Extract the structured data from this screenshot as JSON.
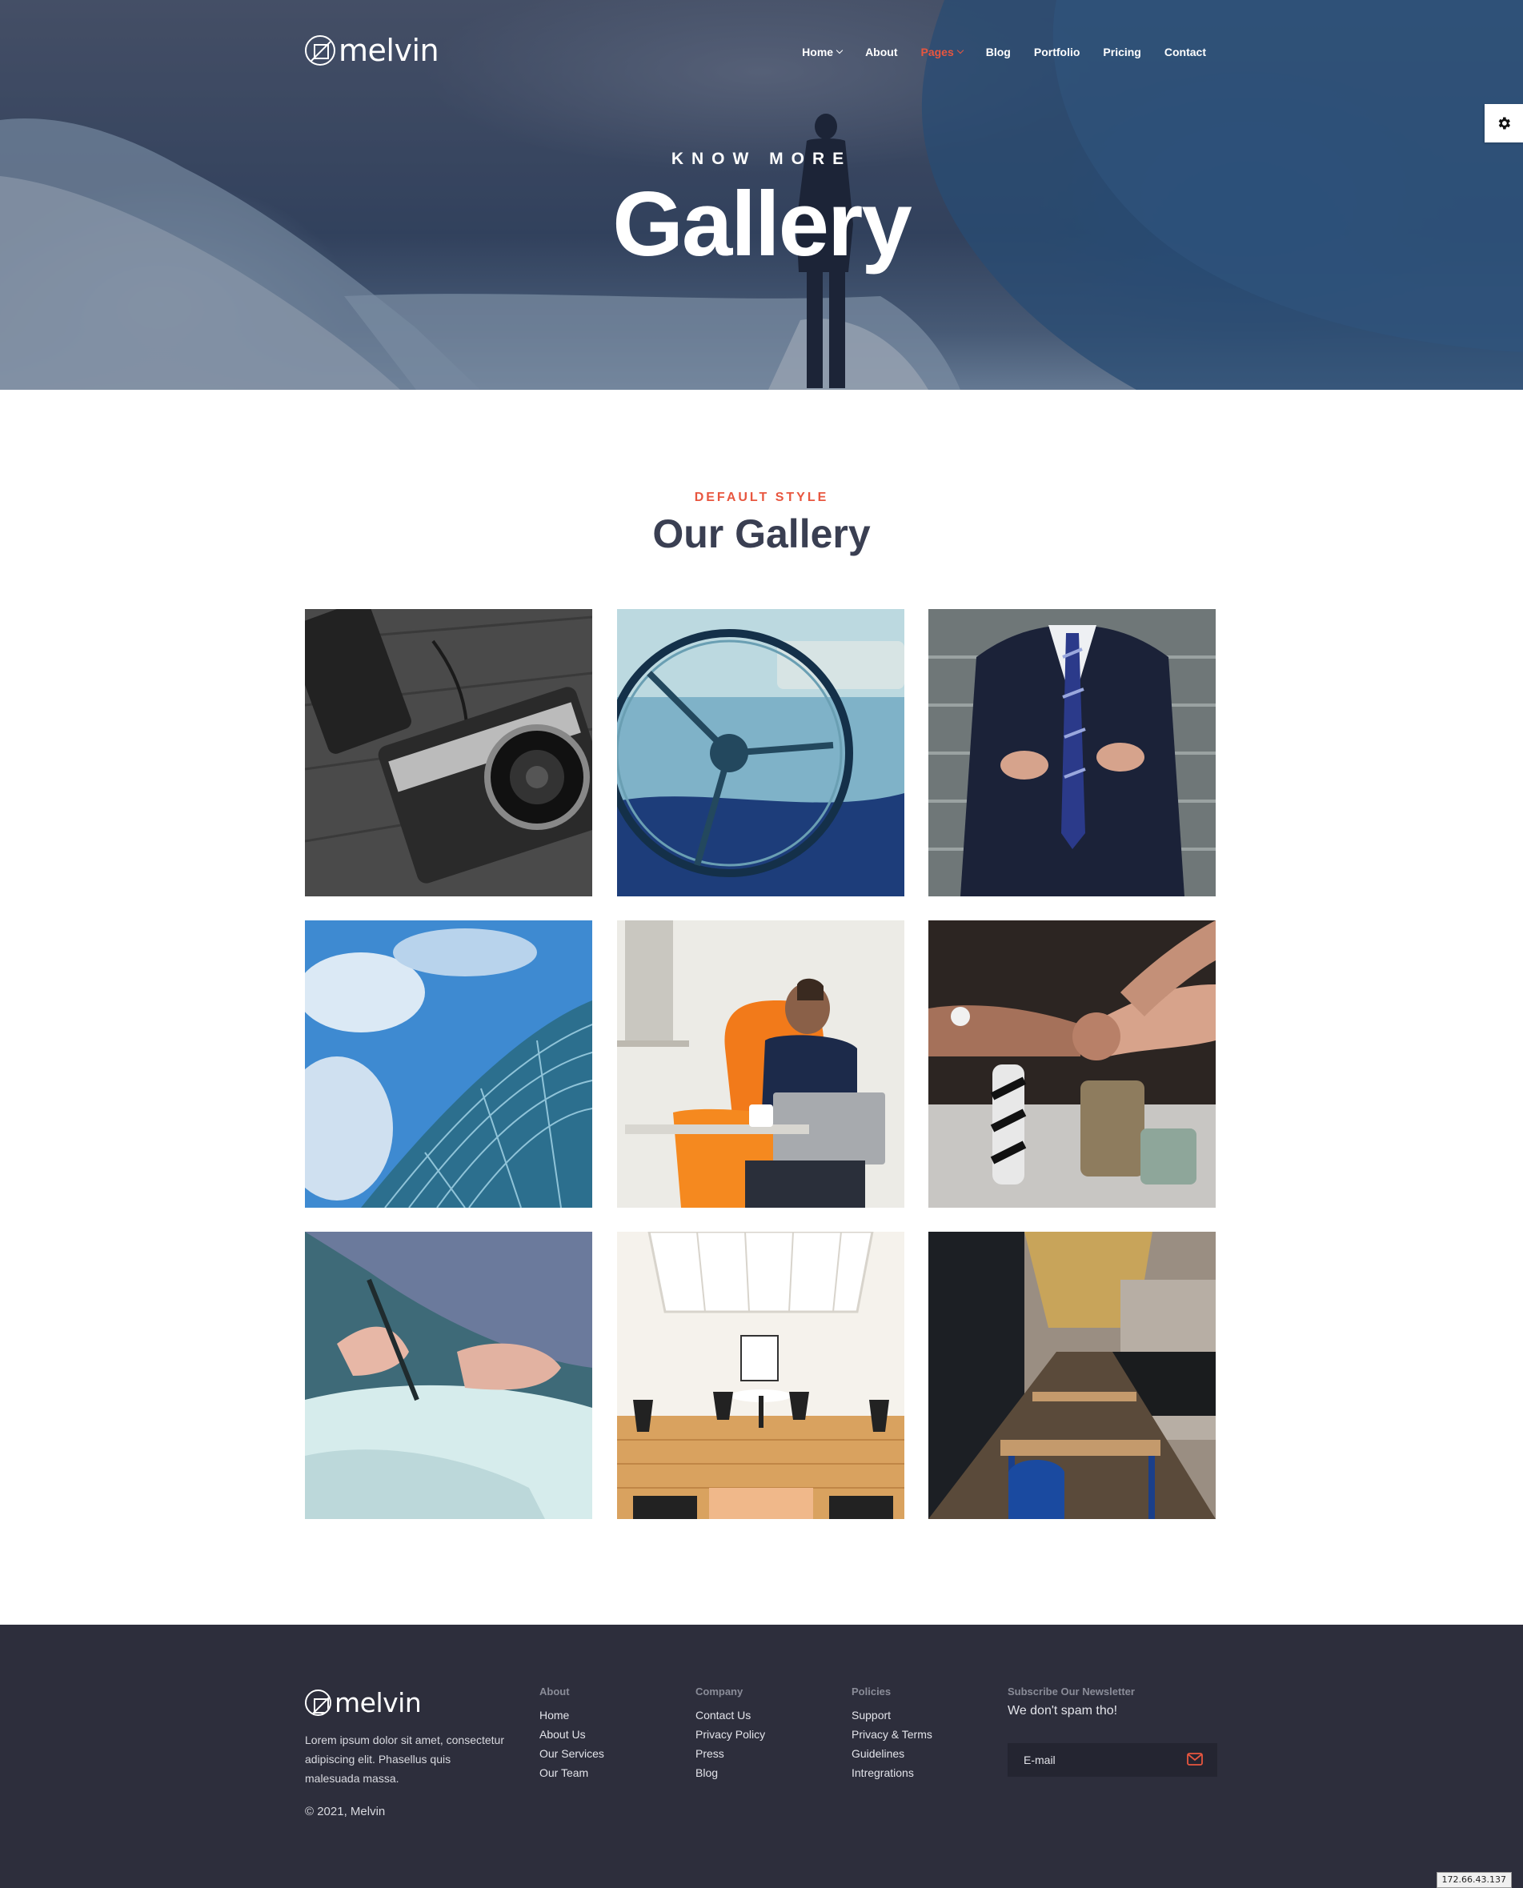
{
  "brand": {
    "name": "melvin"
  },
  "nav": {
    "items": [
      {
        "label": "Home",
        "has_dropdown": true,
        "active": false
      },
      {
        "label": "About",
        "has_dropdown": false,
        "active": false
      },
      {
        "label": "Pages",
        "has_dropdown": true,
        "active": true
      },
      {
        "label": "Blog",
        "has_dropdown": false,
        "active": false
      },
      {
        "label": "Portfolio",
        "has_dropdown": false,
        "active": false
      },
      {
        "label": "Pricing",
        "has_dropdown": false,
        "active": false
      },
      {
        "label": "Contact",
        "has_dropdown": false,
        "active": false
      }
    ]
  },
  "hero": {
    "kicker": "KNOW MORE",
    "title": "Gallery"
  },
  "gallery": {
    "kicker": "DEFAULT STYLE",
    "title": "Our Gallery",
    "images": [
      {
        "subject": "vintage camera (black and white)"
      },
      {
        "subject": "classic car steering wheel"
      },
      {
        "subject": "man in suit and tie"
      },
      {
        "subject": "glass office building and sky"
      },
      {
        "subject": "man with laptop in orange chair"
      },
      {
        "subject": "team fist bump over desk"
      },
      {
        "subject": "hand signing a document"
      },
      {
        "subject": "bright dining room interior"
      },
      {
        "subject": "long cafe hall with tables"
      }
    ]
  },
  "footer": {
    "about_text": "Lorem ipsum dolor sit amet, consectetur adipiscing elit. Phasellus quis malesuada massa.",
    "copyright": "© 2021, Melvin",
    "columns": [
      {
        "heading": "About",
        "links": [
          "Home",
          "About Us",
          "Our Services",
          "Our Team"
        ]
      },
      {
        "heading": "Company",
        "links": [
          "Contact Us",
          "Privacy Policy",
          "Press",
          "Blog"
        ]
      },
      {
        "heading": "Policies",
        "links": [
          "Support",
          "Privacy & Terms",
          "Guidelines",
          "Intregrations"
        ]
      }
    ],
    "newsletter": {
      "heading": "Subscribe Our Newsletter",
      "tagline": "We don't spam tho!",
      "placeholder": "E-mail"
    }
  },
  "ip_badge": "172.66.43.137",
  "colors": {
    "accent": "#e8563f",
    "footer_bg": "#2d2e3c",
    "heading": "#3a3f52"
  },
  "icons": [
    "logo-mark-icon",
    "chevron-down-icon",
    "gear-icon",
    "envelope-icon"
  ]
}
